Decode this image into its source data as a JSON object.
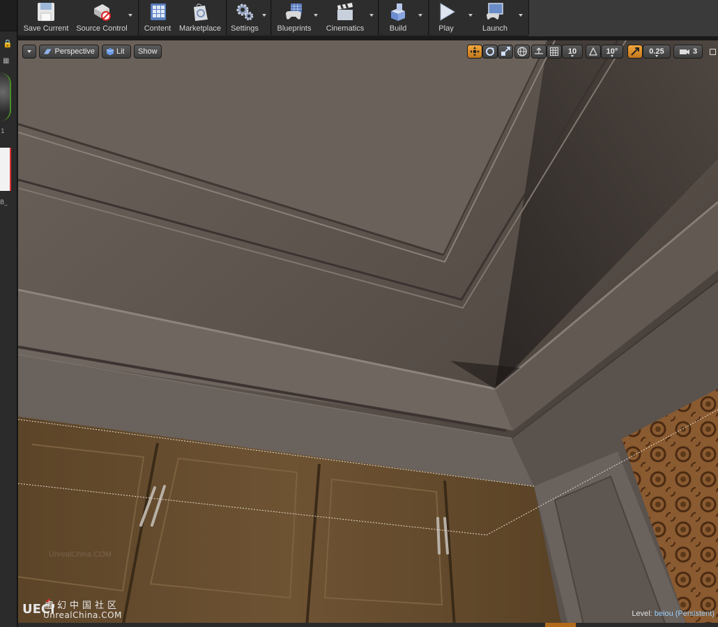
{
  "toolbar": {
    "buttons": [
      {
        "id": "save",
        "label": "Save Current",
        "icon": "floppy-disk-icon"
      },
      {
        "id": "source",
        "label": "Source Control",
        "icon": "source-control-icon"
      },
      {
        "id": "content",
        "label": "Content",
        "icon": "content-grid-icon"
      },
      {
        "id": "marketplace",
        "label": "Marketplace",
        "icon": "marketplace-bag-icon"
      },
      {
        "id": "settings",
        "label": "Settings",
        "icon": "gears-icon"
      },
      {
        "id": "blueprints",
        "label": "Blueprints",
        "icon": "blueprint-controller-icon"
      },
      {
        "id": "cinematics",
        "label": "Cinematics",
        "icon": "clapperboard-icon"
      },
      {
        "id": "build",
        "label": "Build",
        "icon": "build-blocks-icon"
      },
      {
        "id": "play",
        "label": "Play",
        "icon": "play-triangle-icon"
      },
      {
        "id": "launch",
        "label": "Launch",
        "icon": "launch-monitor-icon"
      }
    ]
  },
  "left_panel": {
    "count_text": "1",
    "asset_label_text": "B_"
  },
  "viewport": {
    "view_mode": "Perspective",
    "lighting_mode": "Lit",
    "show_label": "Show",
    "grid_snap_value": "10",
    "rotation_snap_value": "10°",
    "scale_snap_value": "0.25",
    "camera_speed_value": "3",
    "level_label": "Level:",
    "level_name": "beiou (Persistent)",
    "faint_watermark": "UnrealChina.COM"
  },
  "watermark": {
    "chinese": "虚幻中国社区",
    "english": "UnrealChina.COM"
  },
  "colors": {
    "accent_orange": "#e08a20",
    "ceiling": "#5d544e",
    "wood": "#6b4e2e"
  }
}
